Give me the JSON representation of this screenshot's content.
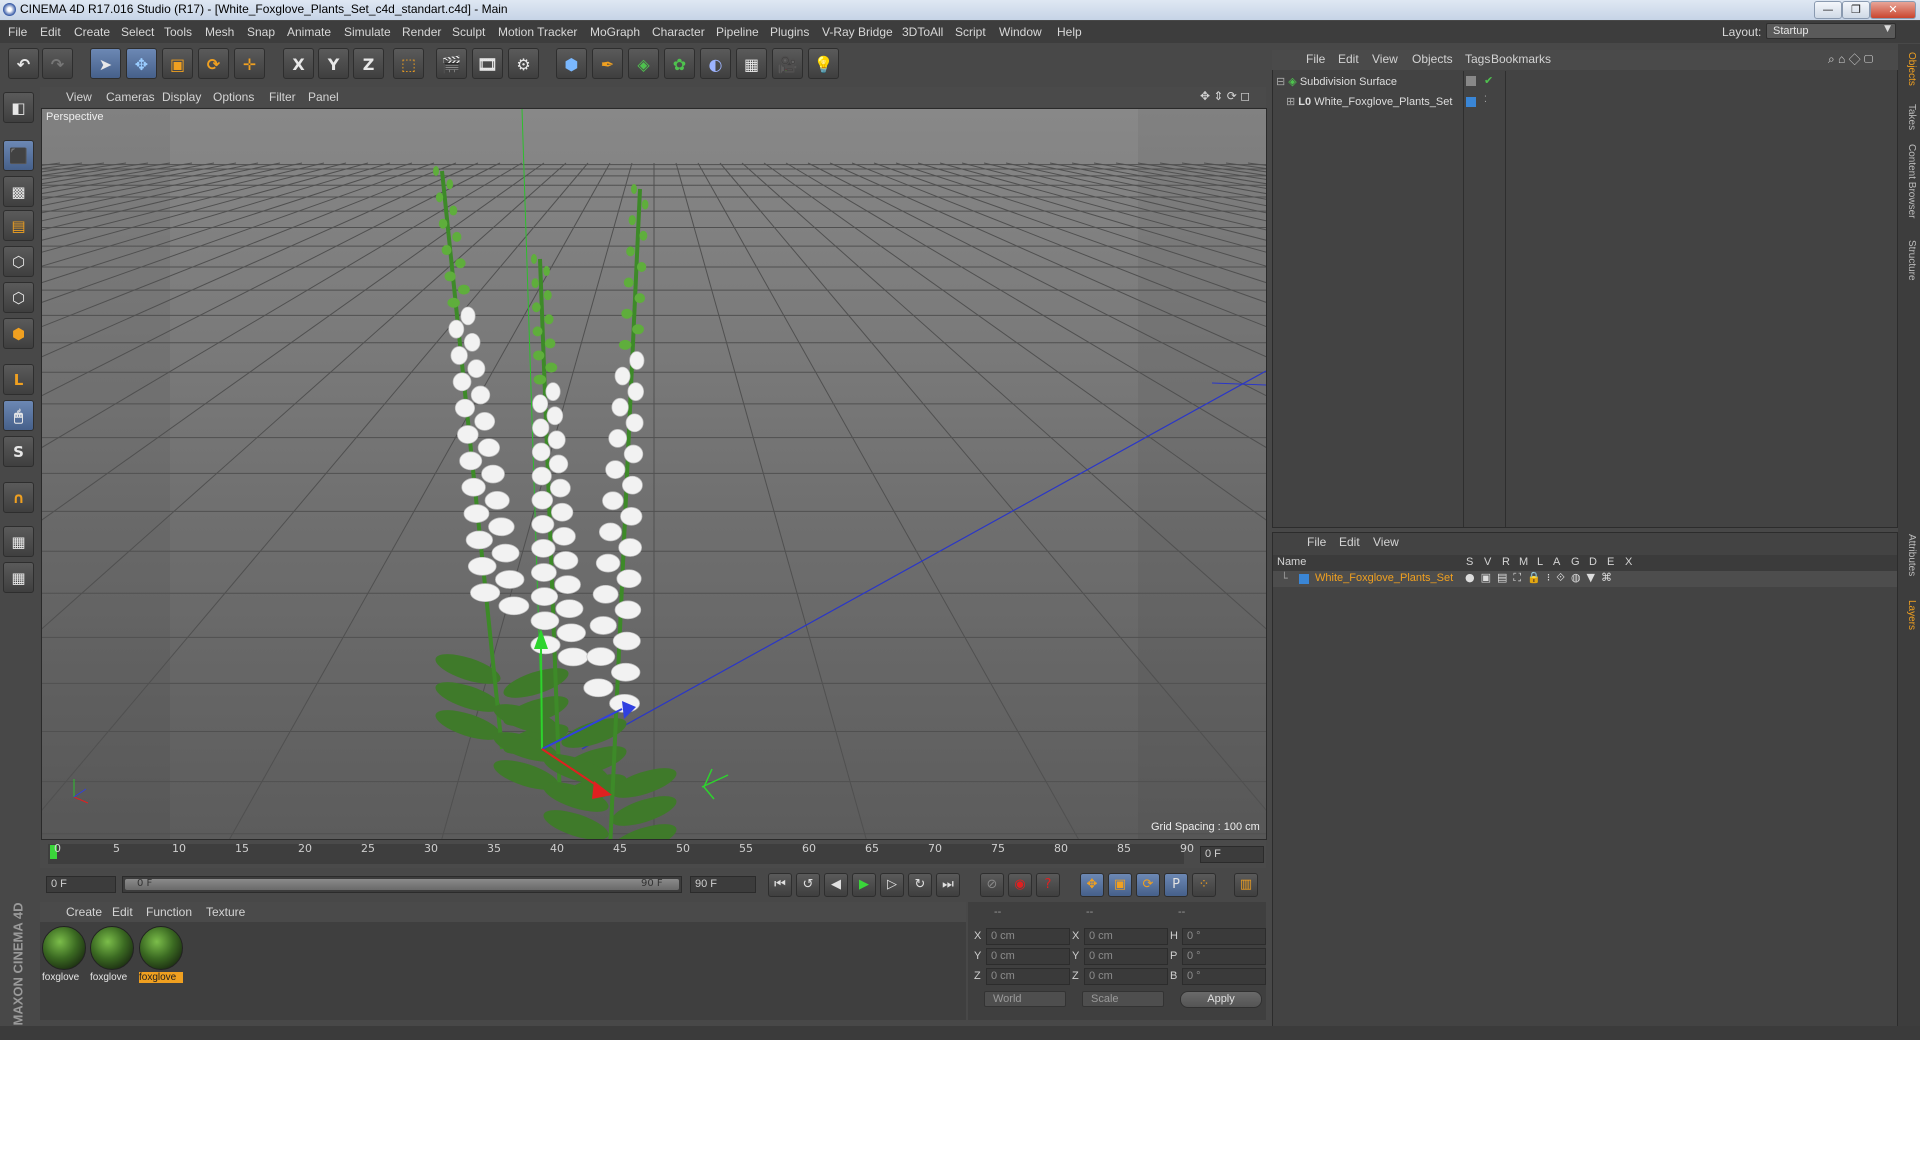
{
  "window": {
    "title": "CINEMA 4D R17.016 Studio (R17) - [White_Foxglove_Plants_Set_c4d_standart.c4d] - Main",
    "min": "—",
    "max": "❐",
    "close": "✕"
  },
  "menubar": {
    "items": [
      "File",
      "Edit",
      "Create",
      "Select",
      "Tools",
      "Mesh",
      "Snap",
      "Animate",
      "Simulate",
      "Render",
      "Sculpt",
      "Motion Tracker",
      "MoGraph",
      "Character",
      "Pipeline",
      "Plugins",
      "V-Ray Bridge",
      "3DToAll",
      "Script",
      "Window",
      "Help"
    ],
    "layout_label": "Layout:",
    "layout_value": "Startup"
  },
  "toolbar": {
    "axis_x": "X",
    "axis_y": "Y",
    "axis_z": "Z"
  },
  "viewport": {
    "menu": [
      "View",
      "Cameras",
      "Display",
      "Options",
      "Filter",
      "Panel"
    ],
    "label": "Perspective",
    "grid_spacing": "Grid Spacing : 100 cm"
  },
  "timeline": {
    "ticks": [
      "0",
      "5",
      "10",
      "15",
      "20",
      "25",
      "30",
      "35",
      "40",
      "45",
      "50",
      "55",
      "60",
      "65",
      "70",
      "75",
      "80",
      "85",
      "90"
    ],
    "current_frame": "0 F",
    "start_field": "0 F",
    "range_start": "0 F",
    "range_end": "90 F",
    "end_field": "90 F"
  },
  "materials": {
    "menu": [
      "Create",
      "Edit",
      "Function",
      "Texture"
    ],
    "items": [
      {
        "label": "foxglove",
        "selected": false
      },
      {
        "label": "foxglove",
        "selected": false
      },
      {
        "label": "foxglove",
        "selected": true
      }
    ]
  },
  "coordinates": {
    "headers": [
      "--",
      "--",
      "--"
    ],
    "rows": [
      {
        "a": "X",
        "av": "0 cm",
        "b": "X",
        "bv": "0 cm",
        "c": "H",
        "cv": "0 °"
      },
      {
        "a": "Y",
        "av": "0 cm",
        "b": "Y",
        "bv": "0 cm",
        "c": "P",
        "cv": "0 °"
      },
      {
        "a": "Z",
        "av": "0 cm",
        "b": "Z",
        "bv": "0 cm",
        "c": "B",
        "cv": "0 °"
      }
    ],
    "mode": "World",
    "mode2": "Scale",
    "apply": "Apply"
  },
  "objects": {
    "menu": [
      "File",
      "Edit",
      "View",
      "Objects",
      "Tags",
      "Bookmarks"
    ],
    "tree": [
      "Subdivision Surface",
      "White_Foxglove_Plants_Set"
    ]
  },
  "layers": {
    "menu": [
      "File",
      "Edit",
      "View"
    ],
    "name_header": "Name",
    "columns": [
      "S",
      "V",
      "R",
      "M",
      "L",
      "A",
      "G",
      "D",
      "E",
      "X"
    ],
    "row": "White_Foxglove_Plants_Set"
  },
  "right_tabs": [
    "Objects",
    "Takes",
    "Content Browser",
    "Structure",
    "Attributes",
    "Layers"
  ],
  "brand": "MAXON CINEMA 4D",
  "colors": {
    "accent_orange": "#f0a020",
    "select_blue": "#5b78a8",
    "axis_green": "#30c030",
    "axis_blue": "#3040d0",
    "axis_red": "#e02020"
  }
}
